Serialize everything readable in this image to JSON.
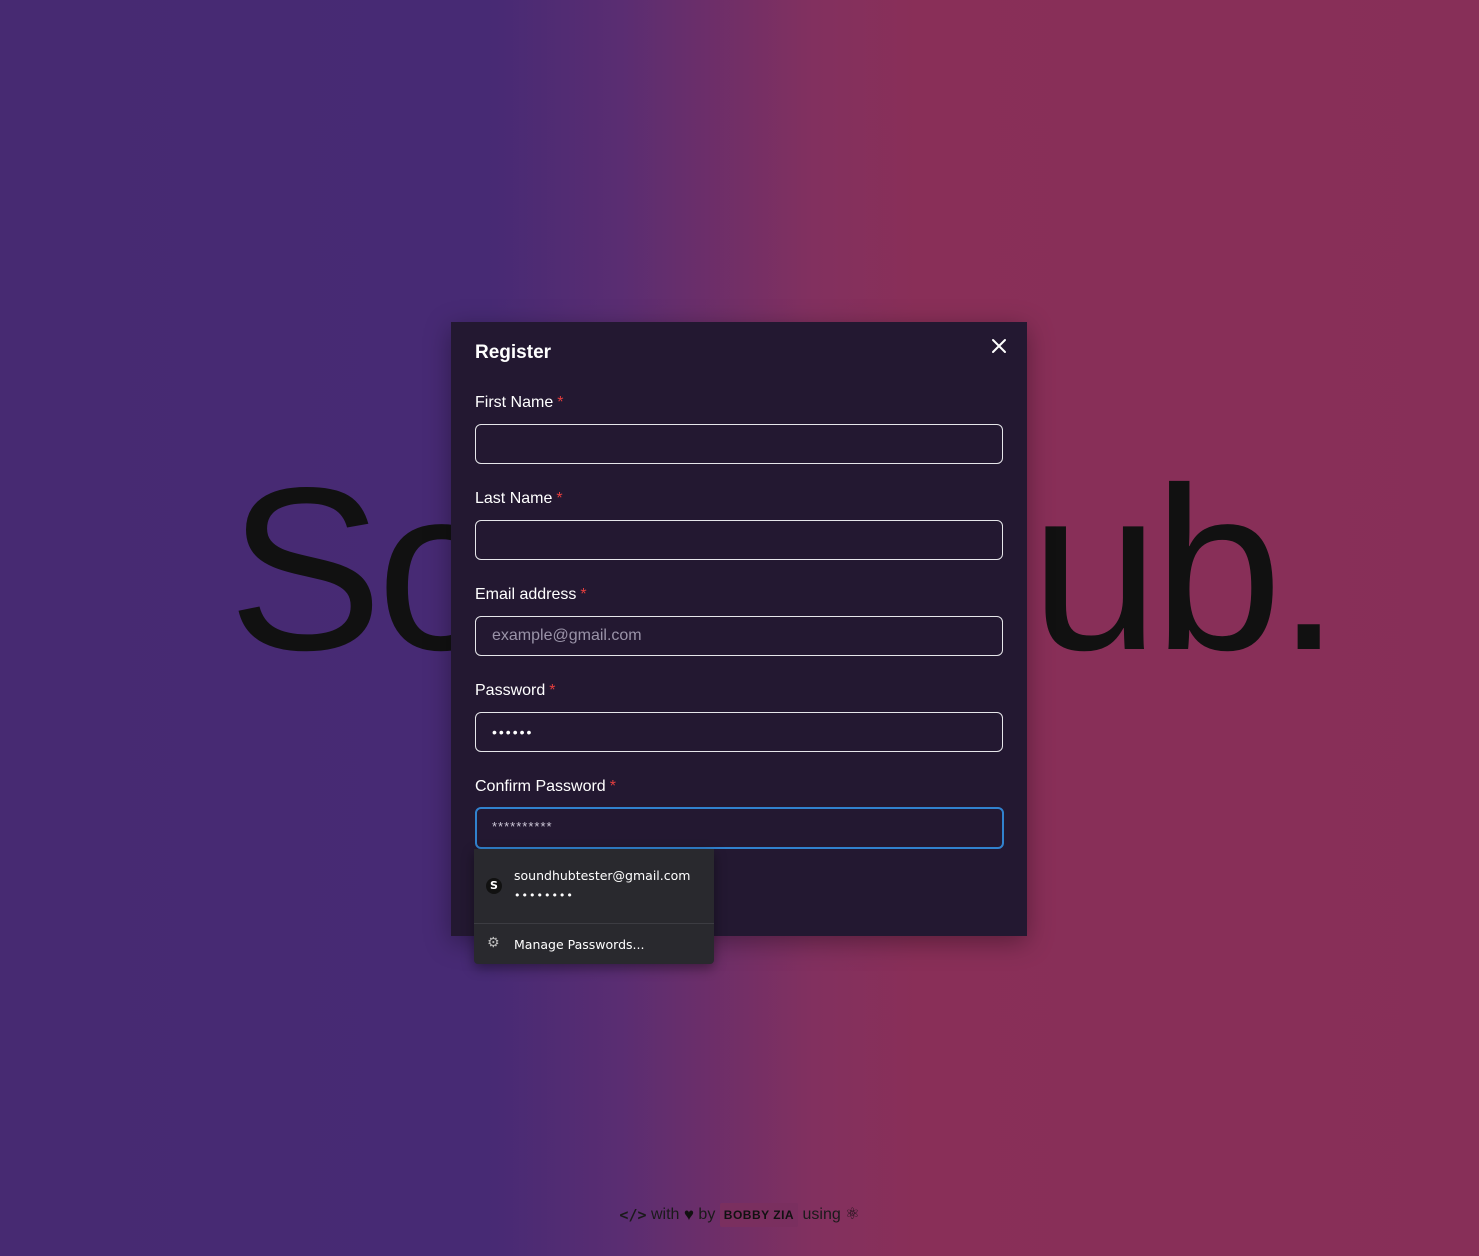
{
  "hero": {
    "text": "SoundHub."
  },
  "modal": {
    "title": "Register",
    "fields": [
      {
        "label": "First Name",
        "required": "*",
        "value": "",
        "placeholder": ""
      },
      {
        "label": "Last Name",
        "required": "*",
        "value": "",
        "placeholder": ""
      },
      {
        "label": "Email address",
        "required": "*",
        "value": "",
        "placeholder": "example@gmail.com"
      },
      {
        "label": "Password",
        "required": "*",
        "value": "••••••",
        "placeholder": ""
      },
      {
        "label": "Confirm Password",
        "required": "*",
        "value": "**********",
        "placeholder": ""
      }
    ]
  },
  "autofill": {
    "email": "soundhubtester@gmail.com",
    "password_mask": "••••••••",
    "site_icon": "S",
    "manage_label": "Manage Passwords..."
  },
  "footer": {
    "code_icon": "</>",
    "with": "with",
    "heart_icon": "♥",
    "by": "by",
    "author": "BOBBY ZIA",
    "using": "using",
    "react_icon": "⚛"
  },
  "colors": {
    "modal_bg": "#231831",
    "required": "#e53e3e",
    "focus_border": "#3182ce",
    "gradient_left": "#472a74",
    "gradient_right": "#892f58"
  }
}
